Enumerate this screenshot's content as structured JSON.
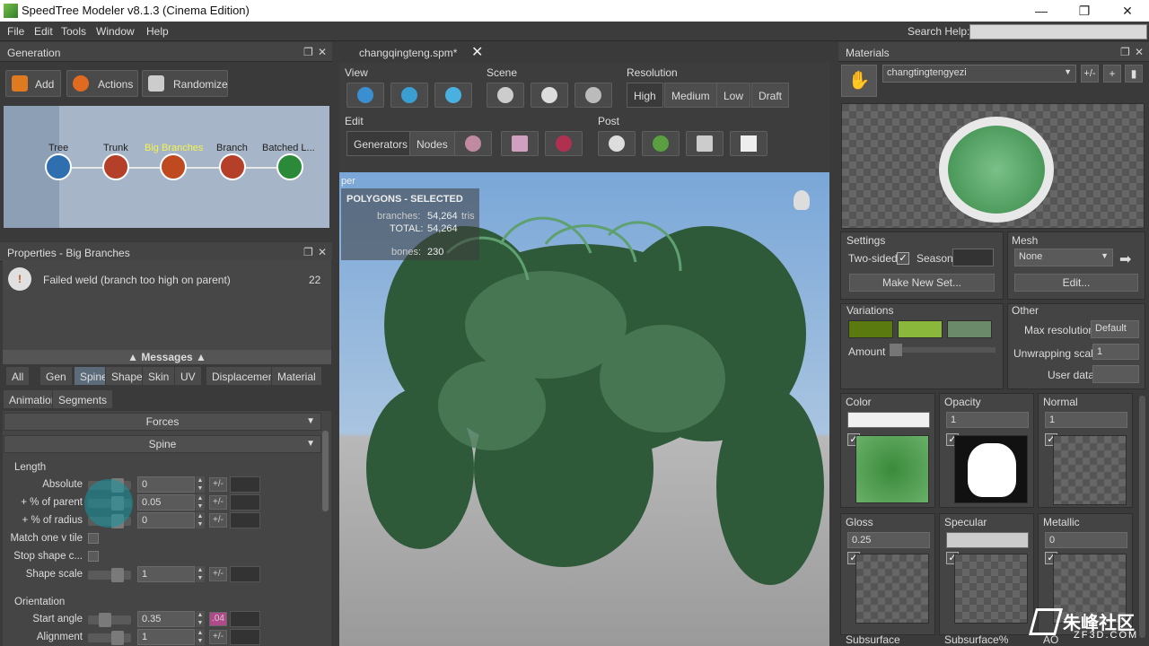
{
  "window": {
    "title": "SpeedTree Modeler v8.1.3 (Cinema Edition)",
    "min": "—",
    "max": "❐",
    "close": "✕"
  },
  "menu": [
    "File",
    "Edit",
    "Tools",
    "Window",
    "Help"
  ],
  "search": {
    "label": "Search Help:",
    "value": ""
  },
  "generation": {
    "title": "Generation",
    "buttons": {
      "add": "Add",
      "actions": "Actions",
      "randomize": "Randomize"
    },
    "nodes": [
      "Tree",
      "Trunk",
      "Big Branches",
      "Branch",
      "Batched L..."
    ]
  },
  "properties": {
    "title": "Properties - Big Branches",
    "message": "Failed weld (branch too high on parent)",
    "message_count": "22",
    "messages_label": "Messages",
    "tabs": [
      "All",
      "Gen",
      "Spine",
      "Shape",
      "Skin",
      "UV",
      "Displacement",
      "Material",
      "Animation",
      "Segments"
    ],
    "sections": {
      "forces": "Forces",
      "spine": "Spine"
    },
    "length_group": "Length",
    "orientation_group": "Orientation",
    "rows": [
      {
        "label": "Absolute",
        "value": "0"
      },
      {
        "label": "+ % of parent",
        "value": "0.05"
      },
      {
        "label": "+ % of radius",
        "value": "0"
      },
      {
        "label": "Match one v tile",
        "value": ""
      },
      {
        "label": "Stop shape c...",
        "value": ""
      },
      {
        "label": "Shape scale",
        "value": "1"
      },
      {
        "label": "Start angle",
        "value": "0.35"
      },
      {
        "label": "Alignment",
        "value": "1"
      }
    ],
    "pm": "+/-",
    "start_angle_var": ".04"
  },
  "viewport": {
    "tab": "changqingteng.spm*",
    "groups": {
      "view": "View",
      "scene": "Scene",
      "resolution": "Resolution",
      "edit": "Edit",
      "post": "Post"
    },
    "resolution": [
      "High",
      "Medium",
      "Low",
      "Draft"
    ],
    "edit_modes": [
      "Generators",
      "Nodes"
    ],
    "info": {
      "header": "POLYGONS - SELECTED",
      "branches_label": "branches:",
      "branches": "54,264",
      "tris": "tris",
      "total_label": "TOTAL:",
      "total": "54,264",
      "bones_label": "bones:",
      "bones": "230"
    },
    "corner": "per"
  },
  "materials": {
    "title": "Materials",
    "name": "changtingtengyezi",
    "pm": "+/-",
    "settings": "Settings",
    "two_sided": "Two-sided",
    "season": "Season",
    "make_new_set": "Make New Set...",
    "mesh": "Mesh",
    "mesh_value": "None",
    "edit": "Edit...",
    "variations": "Variations",
    "amount": "Amount",
    "variation_colors": [
      "#5a7a10",
      "#8ab83a",
      "#6a8a6a"
    ],
    "other": "Other",
    "max_res_label": "Max resolution",
    "max_res": "Default",
    "unwrap_label": "Unwrapping scale",
    "unwrap": "1",
    "user_data": "User data",
    "color": "Color",
    "opacity": "Opacity",
    "opacity_val": "1",
    "normal": "Normal",
    "normal_val": "1",
    "gloss": "Gloss",
    "gloss_val": "0.25",
    "specular": "Specular",
    "metallic": "Metallic",
    "metallic_val": "0",
    "subsurface": "Subsurface",
    "subsurface_pct": "Subsurface%",
    "ao": "AO"
  },
  "watermark": {
    "brand": "朱峰社区",
    "site": "ZF3D.COM"
  }
}
